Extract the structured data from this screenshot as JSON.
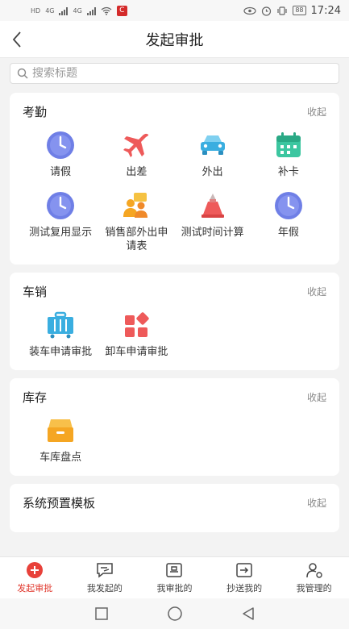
{
  "status_bar": {
    "sim_labels": [
      "HD",
      "4G",
      "4G"
    ],
    "battery": "88",
    "time": "17:24"
  },
  "header": {
    "title": "发起审批"
  },
  "search": {
    "placeholder": "搜索标题"
  },
  "sections": [
    {
      "title": "考勤",
      "action": "收起",
      "items": [
        {
          "label": "请假",
          "icon": "clock-icon",
          "color": "#6f7fe6"
        },
        {
          "label": "出差",
          "icon": "airplane-icon",
          "color": "#ee5a5a"
        },
        {
          "label": "外出",
          "icon": "car-icon",
          "color": "#3aaee0"
        },
        {
          "label": "补卡",
          "icon": "calendar-icon",
          "color": "#3cc6a0"
        },
        {
          "label": "测试复用显示",
          "icon": "clock-icon",
          "color": "#6f7fe6"
        },
        {
          "label": "销售部外出申请表",
          "icon": "people-icon",
          "color": "#f5a623"
        },
        {
          "label": "测试时间计算",
          "icon": "hourglass-icon",
          "color": "#ee5a5a"
        },
        {
          "label": "年假",
          "icon": "clock-icon",
          "color": "#6f7fe6"
        }
      ]
    },
    {
      "title": "车销",
      "action": "收起",
      "items": [
        {
          "label": "装车申请审批",
          "icon": "truck-icon",
          "color": "#3aaee0"
        },
        {
          "label": "卸车申请审批",
          "icon": "blocks-icon",
          "color": "#ee5a5a"
        }
      ]
    },
    {
      "title": "库存",
      "action": "收起",
      "items": [
        {
          "label": "车库盘点",
          "icon": "drawer-icon",
          "color": "#f5a623"
        }
      ]
    },
    {
      "title": "系统预置模板",
      "action": "收起",
      "items": []
    }
  ],
  "tabs": [
    {
      "label": "发起审批",
      "icon": "plus-icon",
      "active": true
    },
    {
      "label": "我发起的",
      "icon": "send-icon",
      "active": false
    },
    {
      "label": "我审批的",
      "icon": "stamp-icon",
      "active": false
    },
    {
      "label": "抄送我的",
      "icon": "forward-icon",
      "active": false
    },
    {
      "label": "我管理的",
      "icon": "user-gear-icon",
      "active": false
    }
  ]
}
